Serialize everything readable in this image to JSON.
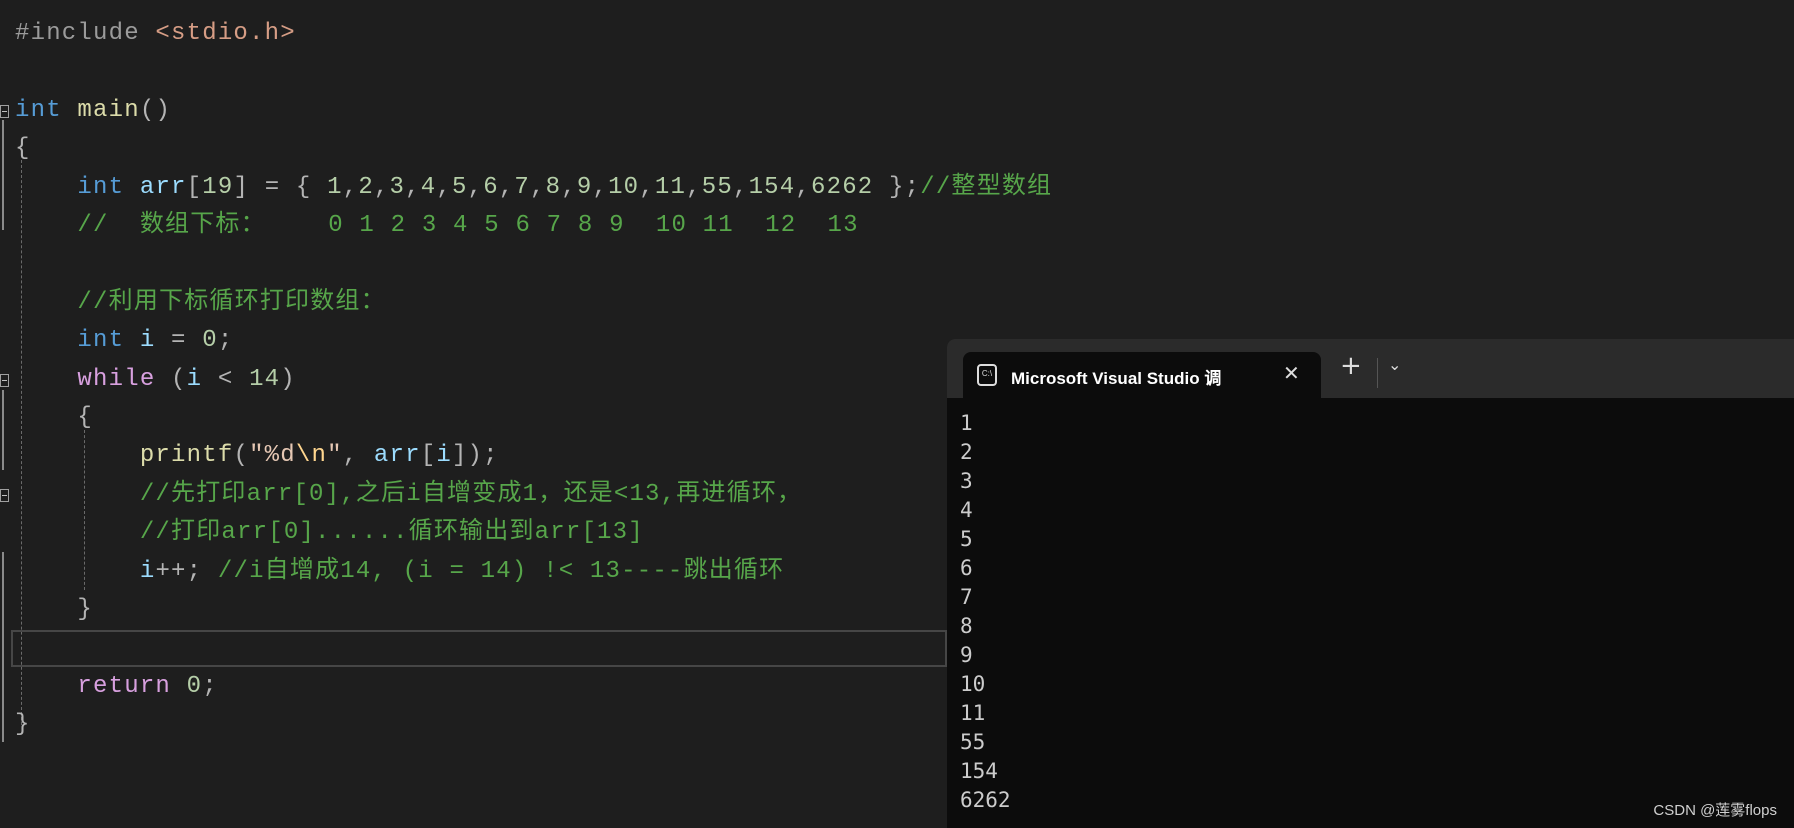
{
  "editor": {
    "lines": [
      [
        [
          "#include ",
          "pp"
        ],
        [
          "<stdio.h>",
          "inc"
        ]
      ],
      [],
      [
        [
          "int",
          "kw"
        ],
        [
          " ",
          "pn"
        ],
        [
          "main",
          "fn"
        ],
        [
          "()",
          "pn"
        ]
      ],
      [
        [
          "{",
          "pn"
        ]
      ],
      [
        [
          "    ",
          "pn"
        ],
        [
          "int",
          "kw"
        ],
        [
          " ",
          "pn"
        ],
        [
          "arr",
          "var"
        ],
        [
          "[",
          "pn"
        ],
        [
          "19",
          "num"
        ],
        [
          "] = { ",
          "pn"
        ],
        [
          "1",
          "num"
        ],
        [
          ",",
          "pn"
        ],
        [
          "2",
          "num"
        ],
        [
          ",",
          "pn"
        ],
        [
          "3",
          "num"
        ],
        [
          ",",
          "pn"
        ],
        [
          "4",
          "num"
        ],
        [
          ",",
          "pn"
        ],
        [
          "5",
          "num"
        ],
        [
          ",",
          "pn"
        ],
        [
          "6",
          "num"
        ],
        [
          ",",
          "pn"
        ],
        [
          "7",
          "num"
        ],
        [
          ",",
          "pn"
        ],
        [
          "8",
          "num"
        ],
        [
          ",",
          "pn"
        ],
        [
          "9",
          "num"
        ],
        [
          ",",
          "pn"
        ],
        [
          "10",
          "num"
        ],
        [
          ",",
          "pn"
        ],
        [
          "11",
          "num"
        ],
        [
          ",",
          "pn"
        ],
        [
          "55",
          "num"
        ],
        [
          ",",
          "pn"
        ],
        [
          "154",
          "num"
        ],
        [
          ",",
          "pn"
        ],
        [
          "6262",
          "num"
        ],
        [
          " };",
          "pn"
        ],
        [
          "//整型数组",
          "cm"
        ]
      ],
      [
        [
          "    //  数组下标：    0 1 2 3 4 5 6 7 8 9  10 11  12  13",
          "cm"
        ]
      ],
      [],
      [
        [
          "    //利用下标循环打印数组：",
          "cm"
        ]
      ],
      [
        [
          "    ",
          "pn"
        ],
        [
          "int",
          "kw"
        ],
        [
          " ",
          "pn"
        ],
        [
          "i",
          "var"
        ],
        [
          " = ",
          "pn"
        ],
        [
          "0",
          "num"
        ],
        [
          ";",
          "pn"
        ]
      ],
      [
        [
          "    ",
          "pn"
        ],
        [
          "while",
          "ctl"
        ],
        [
          " (",
          "pn"
        ],
        [
          "i",
          "var"
        ],
        [
          " < ",
          "pn"
        ],
        [
          "14",
          "num"
        ],
        [
          ")",
          "pn"
        ]
      ],
      [
        [
          "    {",
          "pn"
        ]
      ],
      [
        [
          "        ",
          "pn"
        ],
        [
          "printf",
          "fn"
        ],
        [
          "(",
          "pn"
        ],
        [
          "\"%d",
          "str"
        ],
        [
          "\\n",
          "esc"
        ],
        [
          "\"",
          "str"
        ],
        [
          ", ",
          "pn"
        ],
        [
          "arr",
          "var"
        ],
        [
          "[",
          "pn"
        ],
        [
          "i",
          "var"
        ],
        [
          "]);",
          "pn"
        ]
      ],
      [
        [
          "        //先打印arr[0],之后i自增变成1，还是<13,再进循环，",
          "cm"
        ]
      ],
      [
        [
          "        //打印arr[0]......循环输出到arr[13]",
          "cm"
        ]
      ],
      [
        [
          "        ",
          "pn"
        ],
        [
          "i",
          "var"
        ],
        [
          "++; ",
          "pn"
        ],
        [
          "//i自增成14, (i = 14) !< 13----跳出循环",
          "cm"
        ]
      ],
      [
        [
          "    }",
          "pn"
        ]
      ],
      [],
      [
        [
          "    ",
          "pn"
        ],
        [
          "return",
          "ctl"
        ],
        [
          " ",
          "pn"
        ],
        [
          "0",
          "num"
        ],
        [
          ";",
          "pn"
        ]
      ],
      [
        [
          "}",
          "pn"
        ]
      ]
    ]
  },
  "terminal": {
    "tab_icon": "terminal-icon",
    "tab_icon_text": "C:\\",
    "tab_title": "Microsoft Visual Studio 调试控制台",
    "close_glyph": "✕",
    "new_tab_glyph": "+",
    "dropdown_glyph": "⌄",
    "output": [
      "1",
      "2",
      "3",
      "4",
      "5",
      "6",
      "7",
      "8",
      "9",
      "10",
      "11",
      "55",
      "154",
      "6262"
    ]
  },
  "watermark": "CSDN @莲雾flops"
}
